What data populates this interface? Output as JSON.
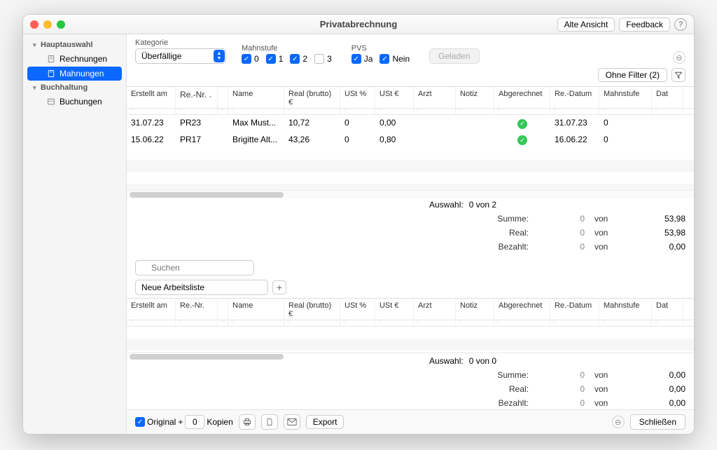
{
  "window": {
    "title": "Privatabrechnung"
  },
  "titlebar": {
    "alte_ansicht": "Alte Ansicht",
    "feedback": "Feedback",
    "help": "?"
  },
  "sidebar": {
    "group1": "Hauptauswahl",
    "item_rechnungen": "Rechnungen",
    "item_mahnungen": "Mahnungen",
    "group2": "Buchhaltung",
    "item_buchungen": "Buchungen"
  },
  "filters": {
    "kategorie_label": "Kategorie",
    "kategorie_value": "Überfällige",
    "mahnstufe_label": "Mahnstufe",
    "ms_0": "0",
    "ms_1": "1",
    "ms_2": "2",
    "ms_3": "3",
    "pvs_label": "PVS",
    "pvs_ja": "Ja",
    "pvs_nein": "Nein",
    "geladen": "Geladen",
    "ohne_filter": "Ohne Filter (2)"
  },
  "columns": {
    "erstellt_am": "Erstellt am",
    "re_nr": "Re.-Nr.",
    "name": "Name",
    "real_brutto": "Real (brutto) €",
    "ust_pct": "USt %",
    "ust_eur": "USt €",
    "arzt": "Arzt",
    "notiz": "Notiz",
    "abgerechnet": "Abgerechnet",
    "re_datum": "Re.-Datum",
    "mahnstufe": "Mahnstufe",
    "datum": "Dat"
  },
  "rows": [
    {
      "erstellt": "31.07.23",
      "renr": "PR23",
      "name": "Max Must...",
      "real": "10,72",
      "ustp": "0",
      "uste": "0,00",
      "arzt": "",
      "notiz": "",
      "redatum": "31.07.23",
      "mahn": "0"
    },
    {
      "erstellt": "15.06.22",
      "renr": "PR17",
      "name": "Brigitte Alt...",
      "real": "43,26",
      "ustp": "0",
      "uste": "0,80",
      "arzt": "",
      "notiz": "",
      "redatum": "16.06.22",
      "mahn": "0"
    }
  ],
  "summary1": {
    "auswahl_lbl": "Auswahl:",
    "auswahl_val": "0 von 2",
    "summe_lbl": "Summe:",
    "summe_a": "0",
    "summe_von": "von",
    "summe_b": "53,98",
    "real_lbl": "Real:",
    "real_a": "0",
    "real_von": "von",
    "real_b": "53,98",
    "bezahlt_lbl": "Bezahlt:",
    "bezahlt_a": "0",
    "bezahlt_von": "von",
    "bezahlt_b": "0,00"
  },
  "search": {
    "placeholder": "Suchen"
  },
  "worklist": {
    "value": "Neue Arbeitsliste"
  },
  "summary2": {
    "auswahl_lbl": "Auswahl:",
    "auswahl_val": "0 von 0",
    "summe_lbl": "Summe:",
    "summe_a": "0",
    "summe_von": "von",
    "summe_b": "0,00",
    "real_lbl": "Real:",
    "real_a": "0",
    "real_von": "von",
    "real_b": "0,00",
    "bezahlt_lbl": "Bezahlt:",
    "bezahlt_a": "0",
    "bezahlt_von": "von",
    "bezahlt_b": "0,00"
  },
  "footer": {
    "original": "Original",
    "plus": "+",
    "kopien_val": "0",
    "kopien": "Kopien",
    "export": "Export",
    "close": "Schließen"
  }
}
